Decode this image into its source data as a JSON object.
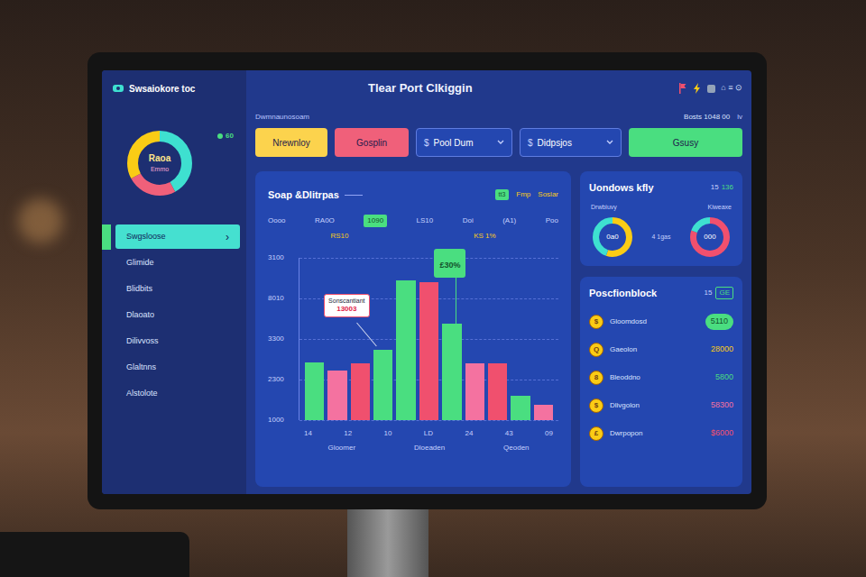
{
  "app": {
    "name": "Swsaiokore toc",
    "title": "Tlear Port Clkiggin",
    "header_meta": "⌂ ≡ ⊙"
  },
  "sidebar": {
    "donut": {
      "label": "Raoa",
      "sublabel": "Emmo",
      "segments": [
        {
          "level": 0.42,
          "color": "#3ee0d0"
        },
        {
          "level": 0.25,
          "color": "#f0607a"
        },
        {
          "level": 0.33,
          "color": "#facc15"
        }
      ]
    },
    "badge": "60",
    "chevron": "›",
    "items": [
      {
        "label": "Swgsloose",
        "selected": true
      },
      {
        "label": "Glimide",
        "selected": false
      },
      {
        "label": "Blidbits",
        "selected": false
      },
      {
        "label": "Dlaoato",
        "selected": false
      },
      {
        "label": "Dilivvoss",
        "selected": false
      },
      {
        "label": "Glaltnns",
        "selected": false
      },
      {
        "label": "Alstolote",
        "selected": false
      }
    ]
  },
  "toolbar": {
    "caption": "Dwmnaunosoam",
    "stats": "Bosts 1048 00",
    "stats_unit": "lv",
    "buttons": [
      {
        "label": "Nrewnloy",
        "kind": "button",
        "color": "#fcd34d"
      },
      {
        "label": "Gosplin",
        "kind": "button",
        "color": "#f0607a"
      },
      {
        "label": "Pool Dum",
        "kind": "dropdown",
        "icon": "$"
      },
      {
        "label": "Didpsjos",
        "kind": "dropdown",
        "icon": "$"
      },
      {
        "label": "Gsusy",
        "kind": "button",
        "color": "#4ade80"
      }
    ]
  },
  "chart": {
    "title": "Soap &Dlitrpas",
    "legend": [
      {
        "label": "tt3",
        "kind": "badge",
        "color": "#4ade80"
      },
      {
        "label": "Fmp",
        "kind": "text",
        "color": "#facc15"
      },
      {
        "label": "Soslar",
        "kind": "text",
        "color": "#facc15"
      }
    ],
    "header_row1": [
      {
        "text": "Oooo",
        "selected": false
      },
      {
        "text": "RA0O",
        "selected": false
      },
      {
        "text": "1090",
        "selected": true
      },
      {
        "text": "LS10",
        "selected": false
      },
      {
        "text": "Doi",
        "selected": false
      },
      {
        "text": "(A1)",
        "selected": false
      },
      {
        "text": "Poo",
        "selected": false
      }
    ],
    "header_row2": [
      "RS10",
      "KS 1%"
    ],
    "y_ticks": [
      "3100",
      "8010",
      "3300",
      "2300",
      "1000"
    ],
    "y_min": 1000,
    "y_max": 3100,
    "bars": [
      {
        "value": 1750,
        "color": "#4ade80"
      },
      {
        "value": 1638,
        "color": "#f472a0"
      },
      {
        "value": 1738,
        "color": "#f0506e"
      },
      {
        "value": 1913,
        "color": "#4ade80"
      },
      {
        "value": 2813,
        "color": "#4ade80"
      },
      {
        "value": 2788,
        "color": "#f0506e"
      },
      {
        "value": 2250,
        "color": "#4ade80"
      },
      {
        "value": 1738,
        "color": "#f472a0"
      },
      {
        "value": 1738,
        "color": "#f0506e"
      },
      {
        "value": 1313,
        "color": "#4ade80"
      },
      {
        "value": 1200,
        "color": "#f472a0"
      }
    ],
    "tooltip": {
      "title": "Sonscantiant",
      "value": "13003",
      "bar": 3
    },
    "badge": {
      "text": "£30%",
      "bar": 6
    },
    "x_ticks": [
      "14",
      "12",
      "10",
      "LD",
      "24",
      "43",
      "09"
    ],
    "x_labels": [
      "Gloomer",
      "Dloeaden",
      "Qeoden"
    ]
  },
  "summary": {
    "title": "Uondows kfly",
    "meta": "15",
    "meta_value": "136",
    "labels": [
      "Drwbiuvy",
      "Kiweaxe"
    ],
    "middle": "4 1gas",
    "donuts": [
      {
        "text": "0a0",
        "segments": [
          {
            "level": 0.55,
            "color": "#facc15"
          },
          {
            "level": 0.45,
            "color": "#3ee0d0"
          }
        ]
      },
      {
        "text": "000",
        "segments": [
          {
            "level": 0.8,
            "color": "#f0506e"
          },
          {
            "level": 0.2,
            "color": "#3ee0d0"
          }
        ]
      }
    ]
  },
  "positions": {
    "title": "Poscfionblock",
    "meta": "15",
    "badge": "GE",
    "rows": [
      {
        "icon": "$",
        "label": "Gloomdosd",
        "value": "5110",
        "kind": "badge",
        "color": "#4ade80"
      },
      {
        "icon": "Q",
        "label": "Gaeolon",
        "value": "28000",
        "kind": "text",
        "color": "#facc15"
      },
      {
        "icon": "8",
        "label": "Bleoddno",
        "value": "5800",
        "kind": "text",
        "color": "#4ade80"
      },
      {
        "icon": "$",
        "label": "Dlivgolon",
        "value": "58300",
        "kind": "text",
        "color": "#f472a0"
      },
      {
        "icon": "£",
        "label": "Dwrpopon",
        "value": "$6000",
        "kind": "text",
        "color": "#f0506e"
      }
    ]
  }
}
